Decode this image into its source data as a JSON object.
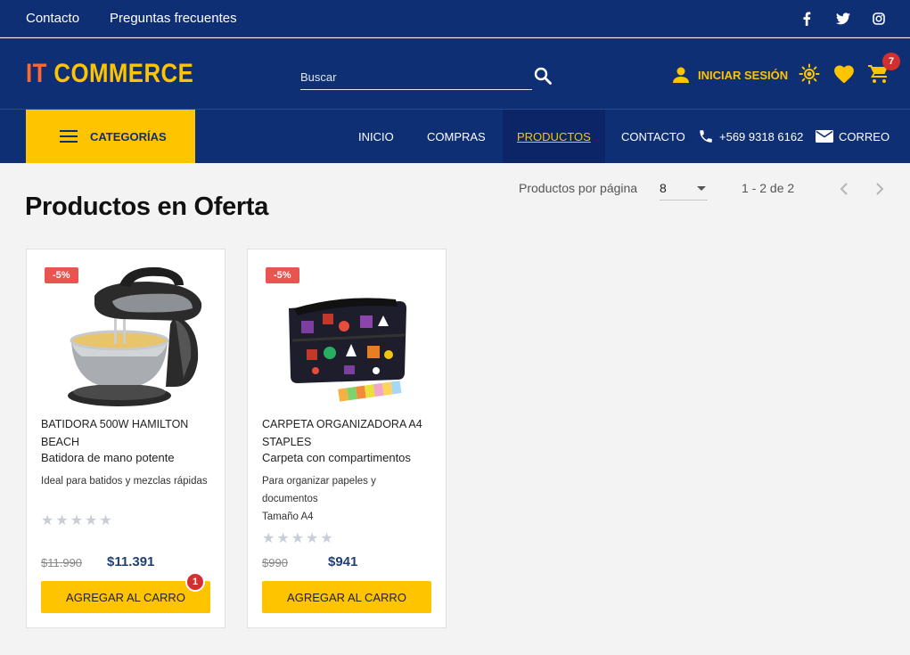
{
  "colors": {
    "navy": "#0f2f75",
    "accent": "#ffc400",
    "logo_orange": "#ff6a2a",
    "discount": "#e95450",
    "badge": "#d32f2f"
  },
  "topbar": {
    "links": [
      "Contacto",
      "Preguntas frecuentes"
    ],
    "social_icons": [
      "facebook-icon",
      "twitter-icon",
      "instagram-icon"
    ]
  },
  "header": {
    "logo_part1": "IT",
    "logo_part2": "COMMERCE",
    "search_placeholder": "Buscar",
    "login_label": "INICIAR SESIÓN",
    "cart_count": "7"
  },
  "nav": {
    "categories_label": "CATEGORÍAS",
    "items": [
      "INICIO",
      "COMPRAS",
      "PRODUCTOS",
      "CONTACTO"
    ],
    "active": "PRODUCTOS",
    "phone": "+569 9318 6162",
    "email_label": "CORREO"
  },
  "main": {
    "title": "Productos en Oferta",
    "per_page_label": "Productos por página",
    "per_page_value": "8",
    "range": "1 - 2 de 2"
  },
  "products": [
    {
      "discount": "-5%",
      "name": "BATIDORA 500W HAMILTON BEACH",
      "subtitle": "Batidora de mano potente",
      "description": "Ideal para batidos y mezclas rápidas",
      "extra": "",
      "rating": 0,
      "stars": "★★★★★",
      "old_price": "$11.990",
      "price": "$11.391",
      "button": "AGREGAR AL CARRO",
      "in_cart": "1"
    },
    {
      "discount": "-5%",
      "name": "CARPETA ORGANIZADORA A4 STAPLES",
      "subtitle": "Carpeta con compartimentos",
      "description": "Para organizar papeles y documentos",
      "extra": "Tamaño A4",
      "rating": 0,
      "stars": "★★★★★",
      "old_price": "$990",
      "price": "$941",
      "button": "AGREGAR AL CARRO"
    }
  ]
}
